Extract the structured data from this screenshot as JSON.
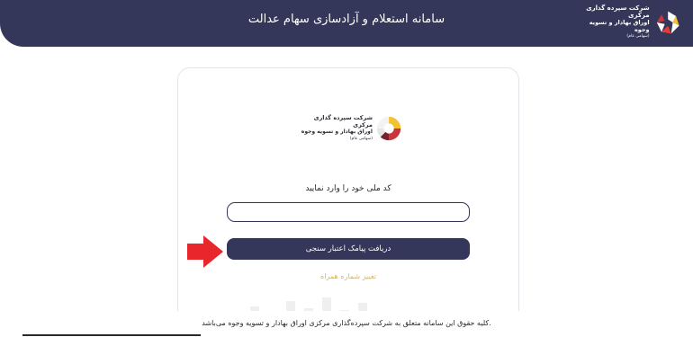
{
  "header": {
    "title": "سامانه استعلام و آزادسازی سهام عدالت",
    "logo": {
      "line1": "شرکت سپرده گذاری مرکزی",
      "line2": "اوراق بهادار و تسویه وجوه",
      "line3": "(سهامی عام)",
      "icon": "company-emblem-icon"
    },
    "colors": {
      "background": "#34375a",
      "text": "#ffffff"
    }
  },
  "card": {
    "logo": {
      "line1": "شرکت سپرده گذاری مرکزی",
      "line2": "اوراق بهادار و تسویه وجوه",
      "line3": "(سهامی عام)",
      "icon": "company-emblem-icon"
    },
    "prompt": "کد ملی خود را وارد نمایید",
    "national_code_input": {
      "value": "",
      "placeholder": ""
    },
    "submit_label": "دریافت پیامک اعتبار سنجی",
    "change_phone_label": "تغییر شماره همراه",
    "colors": {
      "button": "#34375a",
      "link": "#e8b53c"
    }
  },
  "annotation": {
    "arrow_icon": "red-arrow-icon",
    "color": "#e8262b"
  },
  "footer": {
    "text": ".کلیه حقوق این سامانه متعلق به شرکت سپرده‌گذاری مرکزی اوراق بهادار و تسویه وجوه می‌باشد"
  }
}
